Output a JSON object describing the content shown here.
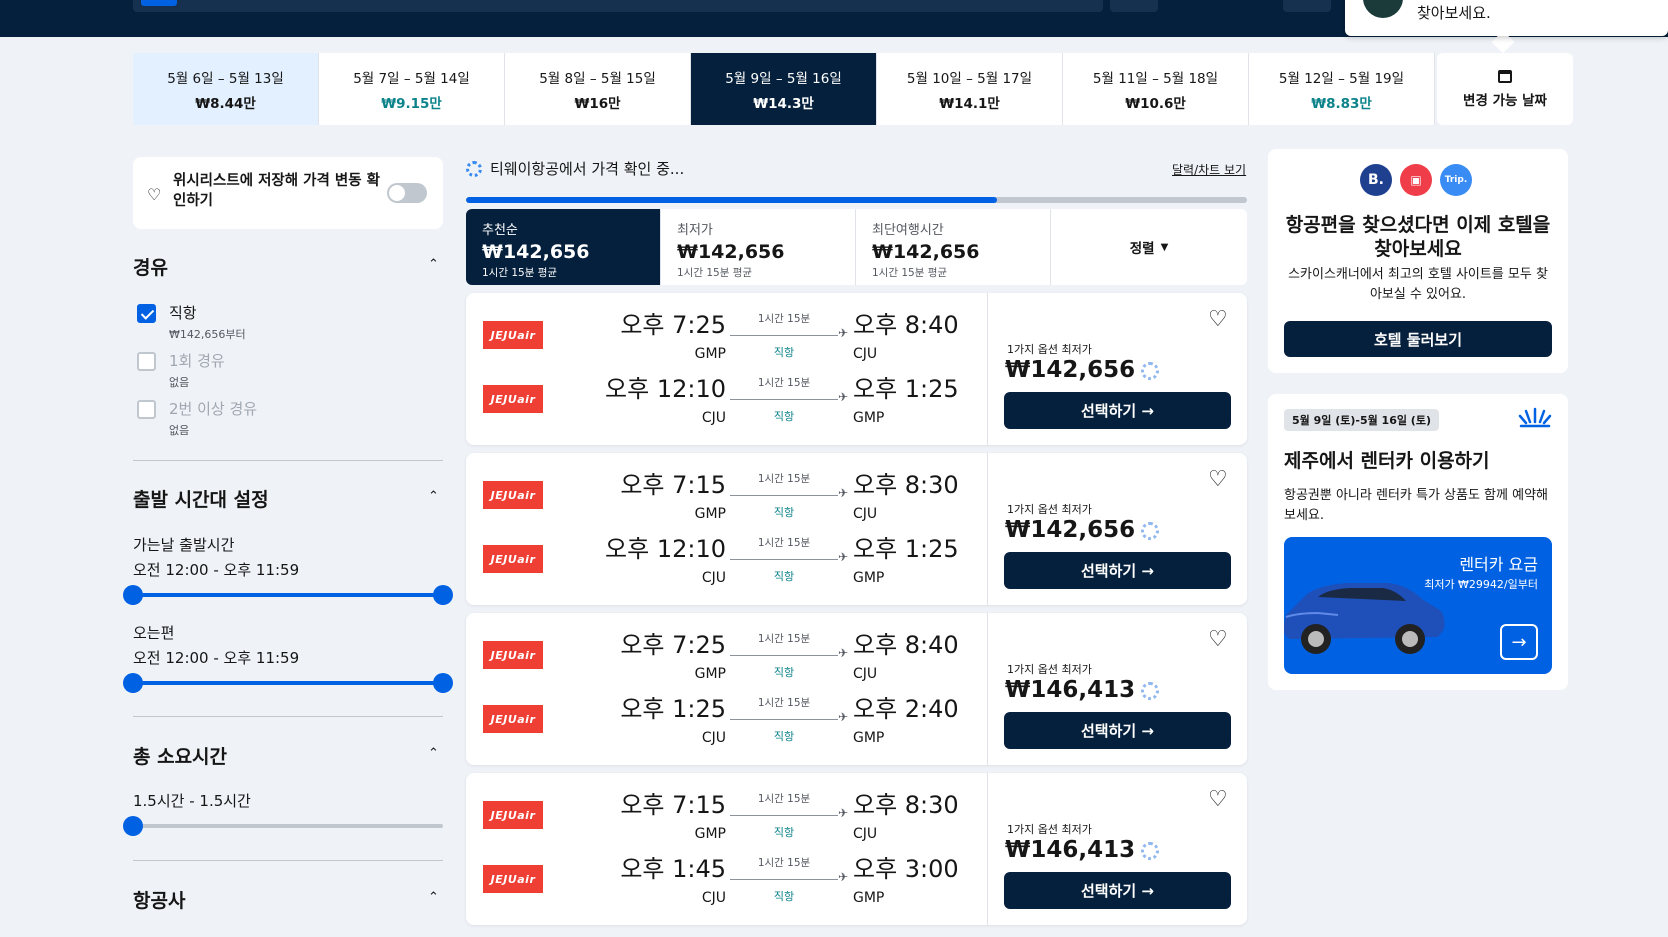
{
  "popup": {
    "text": "찾아보세요."
  },
  "dates": [
    {
      "range": "5월 6일 – 5월 13일",
      "price": "₩8.44만",
      "state": "light",
      "green": false
    },
    {
      "range": "5월 7일 – 5월 14일",
      "price": "₩9.15만",
      "state": "",
      "green": true
    },
    {
      "range": "5월 8일 – 5월 15일",
      "price": "₩16만",
      "state": "",
      "green": false
    },
    {
      "range": "5월 9일 – 5월 16일",
      "price": "₩14.3만",
      "state": "dark",
      "green": false
    },
    {
      "range": "5월 10일 – 5월 17일",
      "price": "₩14.1만",
      "state": "",
      "green": false
    },
    {
      "range": "5월 11일 – 5월 18일",
      "price": "₩10.6만",
      "state": "",
      "green": false
    },
    {
      "range": "5월 12일 – 5월 19일",
      "price": "₩8.83만",
      "state": "",
      "green": true
    }
  ],
  "flexible_dates": "변경 가능 날짜",
  "wishlist": {
    "label": "위시리스트에 저장해 가격 변동 확인하기"
  },
  "filters": {
    "stops": {
      "title": "경유",
      "options": [
        {
          "label": "직항",
          "sub": "₩142,656부터",
          "checked": true,
          "disabled": false
        },
        {
          "label": "1회 경유",
          "sub": "없음",
          "checked": false,
          "disabled": true
        },
        {
          "label": "2번 이상 경유",
          "sub": "없음",
          "checked": false,
          "disabled": true
        }
      ]
    },
    "departure": {
      "title": "출발 시간대 설정",
      "outbound_label": "가는날 출발시간",
      "outbound_range": "오전 12:00 - 오후 11:59",
      "return_label": "오는편",
      "return_range": "오전 12:00 - 오후 11:59"
    },
    "duration": {
      "title": "총 소요시간",
      "range": "1.5시간 - 1.5시간"
    },
    "airlines": {
      "title": "항공사"
    }
  },
  "results": {
    "loading": "티웨이항공에서 가격 확인 중...",
    "calendar_link": "달력/차트 보기",
    "progress": 0.68,
    "sort_tabs": [
      {
        "title": "추천순",
        "price": "₩142,656",
        "sub": "1시간 15분 평균",
        "active": true
      },
      {
        "title": "최저가",
        "price": "₩142,656",
        "sub": "1시간 15분 평균",
        "active": false
      },
      {
        "title": "최단여행시간",
        "price": "₩142,656",
        "sub": "1시간 15분 평균",
        "active": false
      }
    ],
    "sort_label": "정렬",
    "select_label": "선택하기 →",
    "options_label": "1가지 옵션 최저가",
    "airline_logo": "JEJUair",
    "cards": [
      {
        "price": "₩142,656",
        "legs": [
          {
            "dep": "오후 7:25",
            "from": "GMP",
            "dur": "1시간 15분",
            "type": "직항",
            "arr": "오후 8:40",
            "to": "CJU"
          },
          {
            "dep": "오후 12:10",
            "from": "CJU",
            "dur": "1시간 15분",
            "type": "직항",
            "arr": "오후 1:25",
            "to": "GMP"
          }
        ]
      },
      {
        "price": "₩142,656",
        "legs": [
          {
            "dep": "오후 7:15",
            "from": "GMP",
            "dur": "1시간 15분",
            "type": "직항",
            "arr": "오후 8:30",
            "to": "CJU"
          },
          {
            "dep": "오후 12:10",
            "from": "CJU",
            "dur": "1시간 15분",
            "type": "직항",
            "arr": "오후 1:25",
            "to": "GMP"
          }
        ]
      },
      {
        "price": "₩146,413",
        "legs": [
          {
            "dep": "오후 7:25",
            "from": "GMP",
            "dur": "1시간 15분",
            "type": "직항",
            "arr": "오후 8:40",
            "to": "CJU"
          },
          {
            "dep": "오후 1:25",
            "from": "CJU",
            "dur": "1시간 15분",
            "type": "직항",
            "arr": "오후 2:40",
            "to": "GMP"
          }
        ]
      },
      {
        "price": "₩146,413",
        "legs": [
          {
            "dep": "오후 7:15",
            "from": "GMP",
            "dur": "1시간 15분",
            "type": "직항",
            "arr": "오후 8:30",
            "to": "CJU"
          },
          {
            "dep": "오후 1:45",
            "from": "CJU",
            "dur": "1시간 15분",
            "type": "직항",
            "arr": "오후 3:00",
            "to": "GMP"
          }
        ]
      }
    ]
  },
  "hotel_ad": {
    "logos": [
      "B.",
      "",
      "Trip."
    ],
    "title": "항공편을 찾으셨다면 이제 호텔을 찾아보세요",
    "desc": "스카이스캐너에서 최고의 호텔 사이트를 모두 찾아보실 수 있어요.",
    "button": "호텔 둘러보기"
  },
  "car_ad": {
    "badge": "5월 9일 (토)-5월 16일 (토)",
    "title": "제주에서 렌터카 이용하기",
    "desc": "항공권뿐 아니라 렌터카 특가 상품도 함께 예약해보세요.",
    "promo_title": "렌터카 요금",
    "promo_sub": "최저가 ₩29942/일부터"
  }
}
